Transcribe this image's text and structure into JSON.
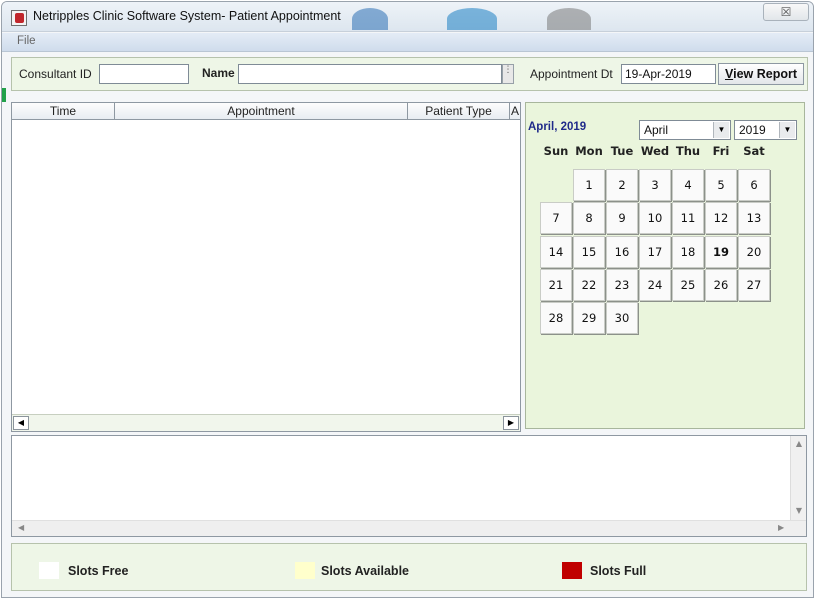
{
  "window": {
    "title": "Netripples Clinic Software System- Patient Appointment",
    "close_label": "☒"
  },
  "menu": {
    "file": "File"
  },
  "toolbar": {
    "consultant_id_label": "Consultant ID",
    "consultant_id_value": "",
    "name_label": "Name",
    "name_value": "",
    "ellipsis": "⋮",
    "appointment_dt_label": "Appointment Dt",
    "appointment_dt_value": "19-Apr-2019",
    "view_report_rest": "iew Report",
    "view_report_mnemonic": "V"
  },
  "grid": {
    "columns": [
      "Time",
      "Appointment",
      "Patient Type",
      "A"
    ],
    "rows": [],
    "scroll_left": "◀",
    "scroll_right": "▶"
  },
  "calendar": {
    "month_title": "April, 2019",
    "month_select": "April",
    "year_select": "2019",
    "dropdown_glyph": "▼",
    "weekdays": [
      "Sun",
      "Mon",
      "Tue",
      "Wed",
      "Thu",
      "Fri",
      "Sat"
    ],
    "first_weekday_index": 1,
    "days_in_month": 30,
    "selected_day": 19
  },
  "detail": {
    "up": "▲",
    "down": "▼",
    "left": "◀",
    "right": "▶"
  },
  "legend": {
    "items": [
      {
        "label": "Slots Free",
        "color": "#ffffff"
      },
      {
        "label": "Slots Available",
        "color": "#ffffcc"
      },
      {
        "label": "Slots Full",
        "color": "#c00000"
      }
    ]
  }
}
